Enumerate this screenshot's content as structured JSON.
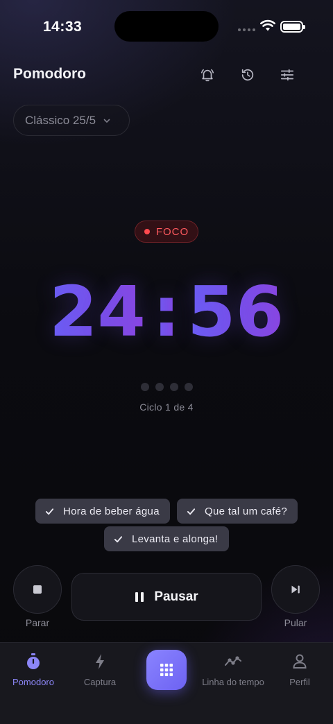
{
  "status_bar": {
    "time": "14:33"
  },
  "header": {
    "title": "Pomodoro",
    "icons": [
      "bell-icon",
      "history-icon",
      "sliders-icon"
    ]
  },
  "preset": {
    "selected": "Clássico 25/5"
  },
  "timer": {
    "phase": "FOCO",
    "minutes": "24",
    "separator": ":",
    "seconds": "56",
    "cycle_text": "Ciclo 1 de 4",
    "cycles_total": 4,
    "cycles_completed": 0
  },
  "reminders": [
    {
      "label": "Hora de beber água"
    },
    {
      "label": "Que tal um café?"
    },
    {
      "label": "Levanta e alonga!"
    }
  ],
  "controls": {
    "stop_label": "Parar",
    "pause_label": "Pausar",
    "skip_label": "Pular"
  },
  "nav": {
    "items": [
      {
        "label": "Pomodoro",
        "icon": "stopwatch-icon",
        "active": true
      },
      {
        "label": "Captura",
        "icon": "bolt-icon",
        "active": false
      },
      {
        "label": "",
        "icon": "grid-icon",
        "active": false
      },
      {
        "label": "Linha do tempo",
        "icon": "timeline-icon",
        "active": false
      },
      {
        "label": "Perfil",
        "icon": "person-icon",
        "active": false
      }
    ]
  },
  "colors": {
    "accent": "#7b74f6",
    "focus_red": "#ff5a5f",
    "timer_gradient_start": "#6a5ff5",
    "timer_gradient_end": "#8c45e0"
  }
}
